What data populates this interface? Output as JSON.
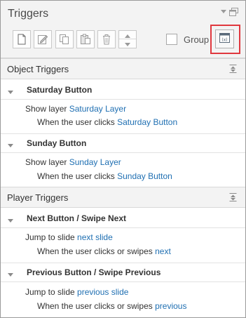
{
  "panel": {
    "title": "Triggers",
    "group_label": "Group"
  },
  "toolbar": {
    "buttons": [
      "new-trigger",
      "edit-trigger",
      "copy-trigger",
      "paste-trigger",
      "delete-trigger",
      "move-up-down"
    ],
    "variables_button_icon": "variables-icon",
    "highlight_color": "#e0383e"
  },
  "sections": [
    {
      "title": "Object Triggers",
      "triggers": [
        {
          "name": "Saturday Button",
          "action_text": "Show layer",
          "action_target": "Saturday Layer",
          "when_text": "When the",
          "when_actor": "user",
          "when_event": "clicks",
          "when_object": "Saturday Button"
        },
        {
          "name": "Sunday Button",
          "action_text": "Show layer",
          "action_target": "Sunday Layer",
          "when_text": "When the",
          "when_actor": "user",
          "when_event": "clicks",
          "when_object": "Sunday Button"
        }
      ]
    },
    {
      "title": "Player Triggers",
      "triggers": [
        {
          "name": "Next Button / Swipe Next",
          "action_text": "Jump to slide",
          "action_target": "next slide",
          "when_text": "When the",
          "when_actor": "user",
          "when_event": "clicks or swipes",
          "when_object": "next"
        },
        {
          "name": "Previous Button / Swipe Previous",
          "action_text": "Jump to slide",
          "action_target": "previous slide",
          "when_text": "When the",
          "when_actor": "user",
          "when_event": "clicks or swipes",
          "when_object": "previous"
        }
      ]
    }
  ],
  "colors": {
    "link": "#1f6fb2",
    "header_bg": "#f3f3f3"
  }
}
